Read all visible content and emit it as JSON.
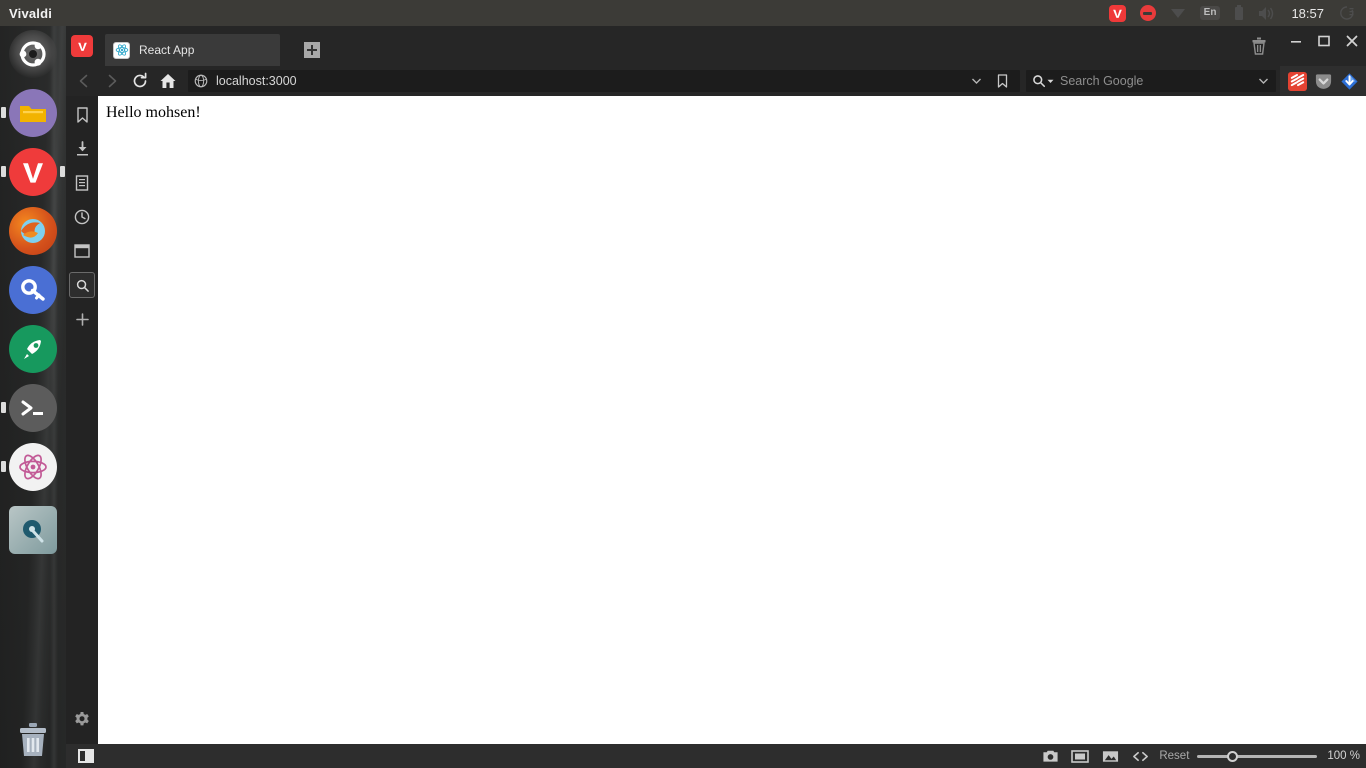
{
  "desktop": {
    "top_panel": {
      "title": "Vivaldi",
      "tray": {
        "vivaldi_icon": "vivaldi-tray-icon",
        "dnd_icon": "do-not-disturb-icon",
        "network_icon": "network-wifi-icon",
        "keyboard_layout": "En",
        "battery_icon": "battery-icon",
        "volume_icon": "volume-speaker-icon",
        "time": "18:57",
        "session_icon": "power-session-icon"
      }
    },
    "launcher": {
      "items": [
        {
          "name": "ubuntu-dash",
          "label": "Ubuntu Dash",
          "icon": "ubuntu-logo-icon",
          "running": false
        },
        {
          "name": "files",
          "label": "Files",
          "icon": "folder-icon",
          "running": true
        },
        {
          "name": "vivaldi",
          "label": "Vivaldi",
          "icon": "vivaldi-logo-icon",
          "running": true,
          "focused": true
        },
        {
          "name": "firefox",
          "label": "Firefox",
          "icon": "firefox-logo-icon",
          "running": false
        },
        {
          "name": "keepass",
          "label": "Password Manager",
          "icon": "key-icon",
          "running": false
        },
        {
          "name": "postman",
          "label": "Postman",
          "icon": "rocket-icon",
          "running": false
        },
        {
          "name": "terminal",
          "label": "Terminal",
          "icon": "terminal-prompt-icon",
          "running": true
        },
        {
          "name": "atom",
          "label": "Atom",
          "icon": "atom-logo-icon",
          "running": true
        },
        {
          "name": "app-misc",
          "label": "Application",
          "icon": "disc-app-icon",
          "running": false
        },
        {
          "name": "trash",
          "label": "Trash",
          "icon": "trash-can-icon",
          "running": false
        }
      ]
    }
  },
  "browser": {
    "menu_button": "vivaldi-menu-icon",
    "tabs": [
      {
        "title": "React App",
        "favicon": "react-logo-icon",
        "active": true
      }
    ],
    "new_tab_label": "+",
    "window_controls": {
      "trash_icon": "trash-can-icon",
      "minimize": "minimize-icon",
      "maximize": "maximize-icon",
      "close": "close-icon"
    },
    "navigation": {
      "back_icon": "back-arrow-icon",
      "forward_icon": "forward-arrow-icon",
      "reload_icon": "reload-icon",
      "home_icon": "home-icon"
    },
    "address_bar": {
      "site_icon": "globe-icon",
      "url": "localhost:3000",
      "dropdown_icon": "chevron-down-icon",
      "bookmark_icon": "bookmark-icon"
    },
    "search_bar": {
      "engine_icon": "search-magnifier-icon",
      "placeholder": "Search Google",
      "value": "",
      "dropdown_icon": "chevron-down-icon"
    },
    "extensions": [
      {
        "name": "todoist",
        "label": "Todoist",
        "color": "#e44332"
      },
      {
        "name": "pocket",
        "label": "Pocket",
        "color": "#8c8c8c"
      },
      {
        "name": "download-helper",
        "label": "Video DownloadHelper",
        "color": "#2d6fd6"
      }
    ],
    "panel": {
      "items": [
        {
          "name": "bookmarks",
          "label": "Bookmarks",
          "icon": "bookmark-icon",
          "active": false
        },
        {
          "name": "downloads",
          "label": "Downloads",
          "icon": "download-icon",
          "active": false
        },
        {
          "name": "notes",
          "label": "Notes",
          "icon": "notes-icon",
          "active": false
        },
        {
          "name": "history",
          "label": "History",
          "icon": "clock-icon",
          "active": false
        },
        {
          "name": "window",
          "label": "Window",
          "icon": "window-icon",
          "active": false
        },
        {
          "name": "search",
          "label": "Search",
          "icon": "search-panel-icon",
          "active": true
        },
        {
          "name": "add-panel",
          "label": "+",
          "icon": "plus-icon",
          "active": false
        }
      ],
      "settings_label": "Settings",
      "settings_icon": "gear-icon"
    },
    "page": {
      "heading": "Hello mohsen!"
    },
    "status_bar": {
      "panel_toggle_icon": "panel-toggle-icon",
      "capture_icon": "camera-capture-icon",
      "tiling_icon": "tile-window-icon",
      "images_icon": "image-toggle-icon",
      "developer_icon": "code-brackets-icon",
      "reset_label": "Reset",
      "zoom_value": "100 %",
      "zoom_percent": 100
    }
  },
  "colors": {
    "accent": "#ef3b3b",
    "chrome_bg": "#262626",
    "panel_bg": "#232323",
    "status_bg": "#2d2d2d",
    "top_panel_bg": "#3c3b37",
    "page_bg": "#ffffff"
  }
}
